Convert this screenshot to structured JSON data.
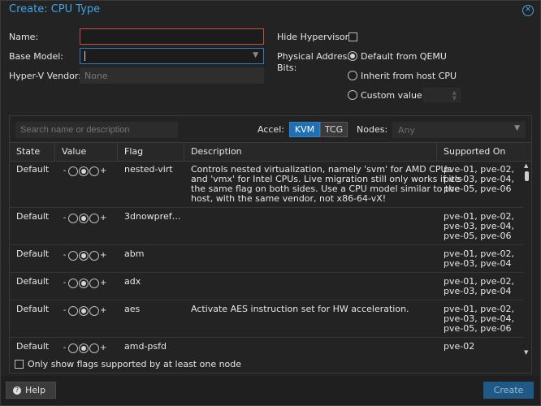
{
  "window": {
    "title": "Create: CPU Type"
  },
  "form": {
    "name_label": "Name:",
    "name_value": "",
    "base_model_label": "Base Model:",
    "base_model_value": "",
    "hyperv_label": "Hyper-V Vendor:",
    "hyperv_placeholder": "None",
    "hide_hypervisor_label": "Hide Hypervisor:",
    "hide_hypervisor_checked": false,
    "phys_addr_label_1": "Physical Address",
    "phys_addr_label_2": "Bits:",
    "phys_options": [
      {
        "label": "Default from QEMU",
        "selected": true
      },
      {
        "label": "Inherit from host CPU",
        "selected": false
      },
      {
        "label": "Custom value",
        "selected": false
      }
    ]
  },
  "flags_panel": {
    "search_placeholder": "Search name or description",
    "accel_label": "Accel:",
    "accel_options": [
      "KVM",
      "TCG"
    ],
    "accel_selected": "KVM",
    "nodes_label": "Nodes:",
    "nodes_placeholder": "Any",
    "columns": [
      "State",
      "Value",
      "Flag",
      "Description",
      "Supported On"
    ],
    "rows": [
      {
        "state": "Default",
        "value": "default",
        "flag": "nested-virt",
        "description": [
          "Controls nested virtualization, namely 'svm' for AMD CPUs",
          "and 'vmx' for Intel CPUs. Live migration still only works if it's",
          "the same flag on both sides. Use a CPU model similar to the",
          "host, with the same vendor, not x86-64-vX!"
        ],
        "supported": [
          "pve-01, pve-02,",
          "pve-03, pve-04,",
          "pve-05, pve-06"
        ]
      },
      {
        "state": "Default",
        "value": "default",
        "flag": "3dnowpref…",
        "description": [],
        "supported": [
          "pve-01, pve-02,",
          "pve-03, pve-04,",
          "pve-05, pve-06"
        ]
      },
      {
        "state": "Default",
        "value": "default",
        "flag": "abm",
        "description": [],
        "supported": [
          "pve-01, pve-02,",
          "pve-03, pve-04"
        ]
      },
      {
        "state": "Default",
        "value": "default",
        "flag": "adx",
        "description": [],
        "supported": [
          "pve-01, pve-02,",
          "pve-03, pve-04"
        ]
      },
      {
        "state": "Default",
        "value": "default",
        "flag": "aes",
        "description": [
          "Activate AES instruction set for HW acceleration."
        ],
        "supported": [
          "pve-01, pve-02,",
          "pve-03, pve-04,",
          "pve-05, pve-06"
        ]
      },
      {
        "state": "Default",
        "value": "default",
        "flag": "amd-psfd",
        "description": [],
        "supported": [
          "pve-02"
        ]
      }
    ],
    "footer_checkbox_label": "Only show flags supported by at least one node",
    "footer_checkbox_checked": false
  },
  "buttons": {
    "help": "Help",
    "create": "Create"
  },
  "colors": {
    "accent": "#3da5e6",
    "kvm_active": "#1f6fb2",
    "error_border": "#c0513a"
  }
}
